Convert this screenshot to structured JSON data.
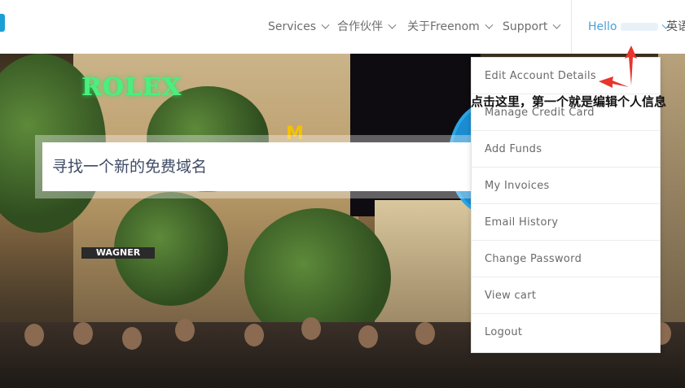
{
  "nav": {
    "items": [
      {
        "label": "Services"
      },
      {
        "label": "合作伙伴"
      },
      {
        "label": "关于Freenom"
      },
      {
        "label": "Support"
      }
    ],
    "hello_label": "Hello",
    "language_label": "英语"
  },
  "search": {
    "placeholder": "寻找一个新的免费域名"
  },
  "hero_signs": {
    "rolex": "ROLEX",
    "mcdonalds": "M",
    "shop": "WAGNER"
  },
  "account_menu": {
    "items": [
      {
        "label": "Edit Account Details"
      },
      {
        "label": "Manage Credit Card"
      },
      {
        "label": "Add Funds"
      },
      {
        "label": "My Invoices"
      },
      {
        "label": "Email History"
      },
      {
        "label": "Change Password"
      },
      {
        "label": "View cart"
      },
      {
        "label": "Logout"
      }
    ]
  },
  "annotation": {
    "note": "点击这里，第一个就是编辑个人信息",
    "arrow_color": "#e8352b"
  },
  "colors": {
    "link_blue": "#4a9fd8",
    "brand_blue": "#1b9fd6"
  }
}
